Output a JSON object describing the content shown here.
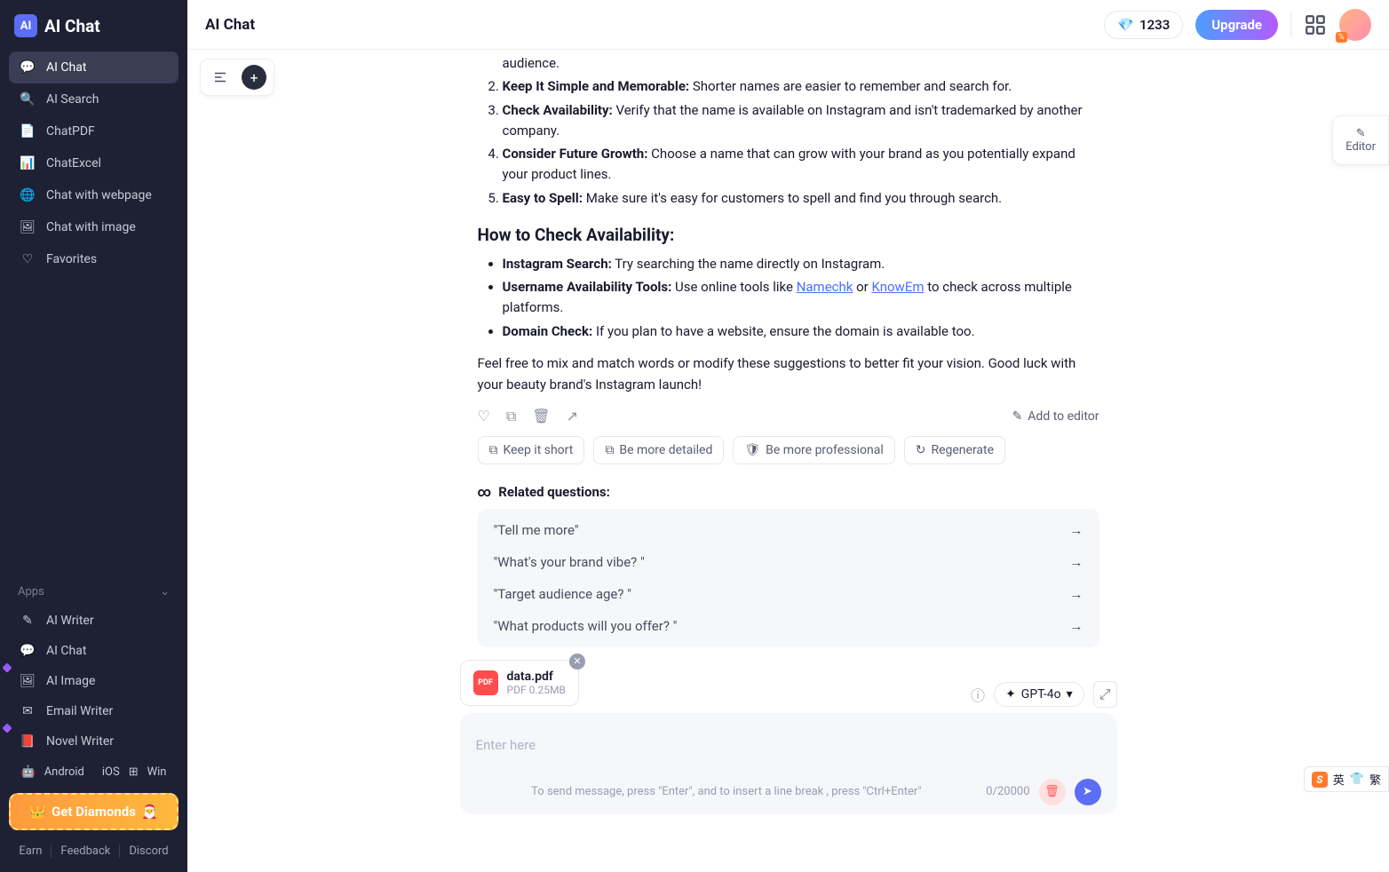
{
  "brand": {
    "name": "AI Chat"
  },
  "sidebar": {
    "items": [
      {
        "label": "AI Chat"
      },
      {
        "label": "AI Search"
      },
      {
        "label": "ChatPDF"
      },
      {
        "label": "ChatExcel"
      },
      {
        "label": "Chat with webpage"
      },
      {
        "label": "Chat with image"
      },
      {
        "label": "Favorites"
      }
    ],
    "apps_header": "Apps",
    "apps": [
      {
        "label": "AI Writer"
      },
      {
        "label": "AI Chat"
      },
      {
        "label": "AI Image"
      },
      {
        "label": "Email Writer"
      },
      {
        "label": "Novel Writer"
      }
    ],
    "platforms": [
      "Android",
      "iOS",
      "Win"
    ],
    "diamonds_label": "Get Diamonds",
    "footer": [
      "Earn",
      "Feedback",
      "Discord"
    ]
  },
  "topbar": {
    "title": "AI Chat",
    "credits": "1233",
    "upgrade": "Upgrade"
  },
  "editor_panel": {
    "label": "Editor"
  },
  "message": {
    "ol_start": 1,
    "ol": [
      {
        "b": "",
        "t": "audience."
      },
      {
        "b": "Keep It Simple and Memorable:",
        "t": " Shorter names are easier to remember and search for."
      },
      {
        "b": "Check Availability:",
        "t": " Verify that the name is available on Instagram and isn't trademarked by another company."
      },
      {
        "b": "Consider Future Growth:",
        "t": " Choose a name that can grow with your brand as you potentially expand your product lines."
      },
      {
        "b": "Easy to Spell:",
        "t": " Make sure it's easy for customers to spell and find you through search."
      }
    ],
    "h3": "How to Check Availability:",
    "ul": [
      {
        "b": "Instagram Search:",
        "t": " Try searching the name directly on Instagram."
      },
      {
        "b": "Username Availability Tools:",
        "pre": " Use online tools like ",
        "link1": "Namechk",
        "mid": " or ",
        "link2": "KnowEm",
        "post": " to check across multiple platforms."
      },
      {
        "b": "Domain Check:",
        "t": " If you plan to have a website, ensure the domain is available too."
      }
    ],
    "closing": "Feel free to mix and match words or modify these suggestions to better fit your vision. Good luck with your beauty brand's Instagram launch!",
    "add_editor": "Add to editor",
    "chips": [
      "Keep it short",
      "Be more detailed",
      "Be more professional",
      "Regenerate"
    ],
    "related_h": "Related questions:",
    "related": [
      "\"Tell me more\"",
      "\"What's your brand vibe? \"",
      "\"Target audience age? \"",
      "\"What products will you offer? \""
    ]
  },
  "file": {
    "name": "data.pdf",
    "type": "PDF",
    "size": "0.25MB"
  },
  "composer": {
    "model": "GPT-4o",
    "placeholder": "Enter here",
    "hint": "To send message, press \"Enter\", and to insert a line break , press \"Ctrl+Enter\"",
    "counter": "0/20000"
  },
  "ime": {
    "lang": "英",
    "extra": "繁"
  }
}
